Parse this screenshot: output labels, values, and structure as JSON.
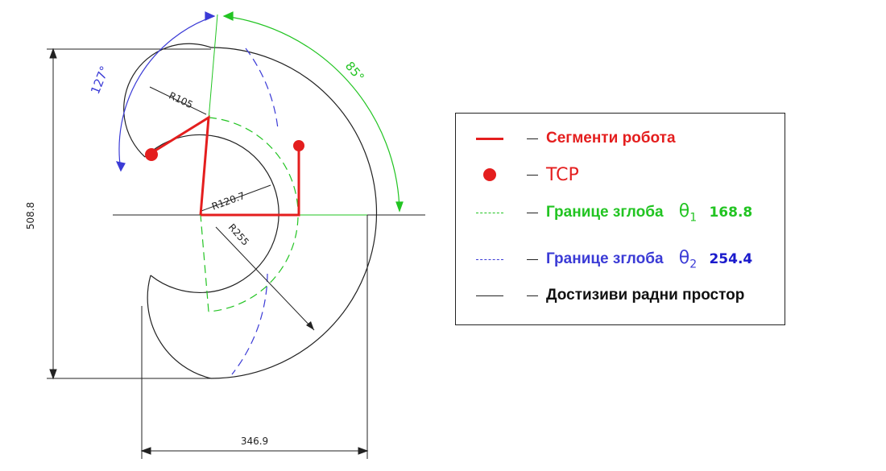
{
  "dimensions": {
    "height": "508.8",
    "width": "346.9",
    "r_small": "R105",
    "r_inner": "R120.7",
    "r_outer": "R255"
  },
  "angles": {
    "theta2_range": "127°",
    "theta1_range": "85°"
  },
  "legend": {
    "segments": "Сегменти робота",
    "tcp": "TCP",
    "joint_limit_1": "Границе зглоба",
    "theta1_symbol": "θ",
    "theta1_sub": "1",
    "theta1_value": "168.8",
    "joint_limit_2": "Границе зглоба",
    "theta2_symbol": "θ",
    "theta2_sub": "2",
    "theta2_value": "254.4",
    "workspace": "Достизиви радни простор"
  },
  "colors": {
    "robot": "#e41e1e",
    "joint1": "#22c422",
    "joint2": "#3b3bd6",
    "workspace": "#222222"
  }
}
